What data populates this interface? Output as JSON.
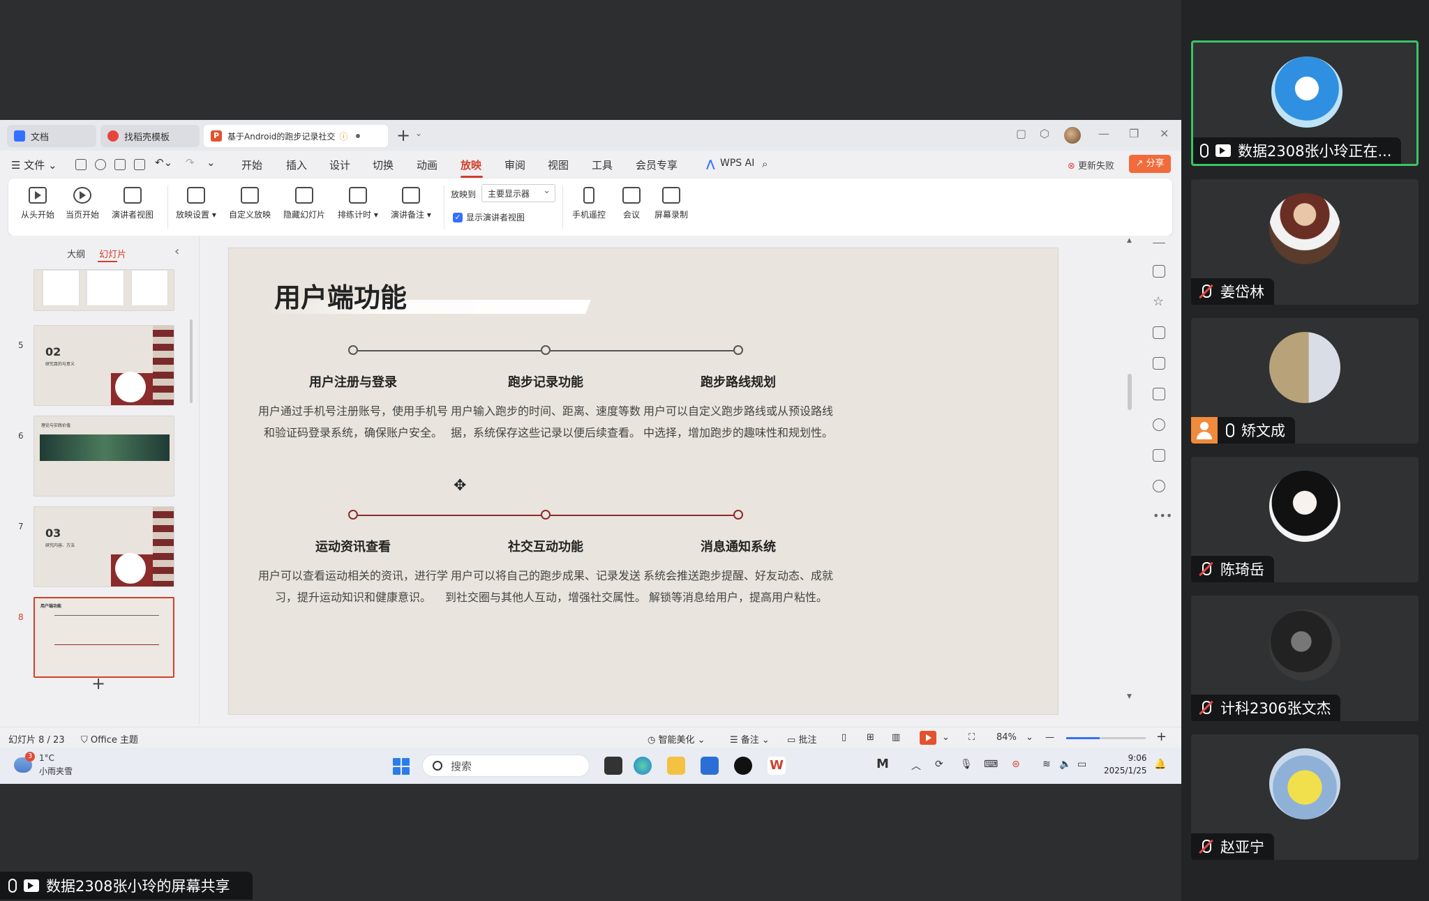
{
  "window": {
    "tabs": [
      {
        "label": "文档"
      },
      {
        "label": "找稻壳模板"
      },
      {
        "label": "基于Android的跑步记录社交",
        "warn": "ⓘ"
      }
    ],
    "tab_plus": "+",
    "menu": {
      "file": "☰ 文件 ⌄",
      "items": [
        "开始",
        "插入",
        "设计",
        "切换",
        "动画",
        "放映",
        "审阅",
        "视图",
        "工具",
        "会员专享"
      ],
      "active": "放映",
      "wps_ai": "WPS AI",
      "update_fail": "更新失败",
      "share": "分享"
    },
    "ribbon": {
      "buttons": [
        "从头开始",
        "当页开始",
        "演讲者视图",
        "放映设置 ▾",
        "自定义放映",
        "隐藏幻灯片",
        "排练计时 ▾",
        "演讲备注 ▾"
      ],
      "play_to_label": "放映到",
      "play_to_value": "主要显示器",
      "show_presenter_view": "显示演讲者视图",
      "right_buttons": [
        "手机遥控",
        "会议",
        "屏幕录制"
      ]
    },
    "left_panel": {
      "tab_outline": "大纲",
      "tab_slides": "幻灯片",
      "collapse": "‹",
      "thumbnails": [
        {
          "num": "",
          "type": "cards"
        },
        {
          "num": "5",
          "big": "02",
          "small": "研究目的与意义",
          "type": "section"
        },
        {
          "num": "6",
          "small": "理论与实践价值",
          "type": "leaf"
        },
        {
          "num": "7",
          "big": "03",
          "small": "研究内容、方法",
          "type": "section"
        },
        {
          "num": "8",
          "small": "用户端功能",
          "type": "current"
        }
      ],
      "add": "+"
    },
    "slide": {
      "title": "用户端功能",
      "features_top": [
        {
          "title": "用户注册与登录",
          "desc": [
            "用户通过手机号注册账号，使用手机号",
            "和验证码登录系统，确保账户安全。"
          ]
        },
        {
          "title": "跑步记录功能",
          "desc": [
            "用户输入跑步的时间、距离、速度等数",
            "据，系统保存这些记录以便后续查看。"
          ]
        },
        {
          "title": "跑步路线规划",
          "desc": [
            "用户可以自定义跑步路线或从预设路线",
            "中选择，增加跑步的趣味性和规划性。"
          ]
        }
      ],
      "features_bottom": [
        {
          "title": "运动资讯查看",
          "desc": [
            "用户可以查看运动相关的资讯，进行学",
            "习，提升运动知识和健康意识。"
          ]
        },
        {
          "title": "社交互动功能",
          "desc": [
            "用户可以将自己的跑步成果、记录发送",
            "到社交圈与其他人互动，增强社交属性。"
          ]
        },
        {
          "title": "消息通知系统",
          "desc": [
            "系统会推送跑步提醒、好友动态、成就",
            "解锁等消息给用户，提高用户粘性。"
          ]
        }
      ]
    },
    "status": {
      "slide_info": "幻灯片 8 / 23",
      "theme": "Office 主题",
      "smart": "智能美化 ⌄",
      "notes": "☰ 备注 ⌄",
      "comment": "批注",
      "zoom": "84%",
      "zoom_minus": "—",
      "zoom_plus": "+",
      "zoom_level": 0.42
    },
    "taskbar": {
      "weather_badge": "3",
      "temp": "1°C",
      "weather": "小雨夹雪",
      "search": "搜索",
      "time": "9:06",
      "date": "2025/1/25"
    }
  },
  "share_label": "数据2308张小玲的屏幕共享",
  "participants": [
    {
      "name": "数据2308张小玲正在...",
      "status": "sharing"
    },
    {
      "name": "姜岱林",
      "status": "muted"
    },
    {
      "name": "矫文成",
      "status": "unmuted"
    },
    {
      "name": "陈琦岳",
      "status": "muted"
    },
    {
      "name": "计科2306张文杰",
      "status": "muted"
    },
    {
      "name": "赵亚宁",
      "status": "muted"
    }
  ],
  "colors": {
    "accent": "#d0402c",
    "speaking_border": "#3cc36a",
    "slide_bg": "#e9e5de",
    "maroon": "#8b2b2b"
  }
}
